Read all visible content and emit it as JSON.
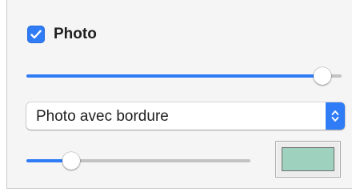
{
  "photo_section": {
    "checkbox": {
      "label": "Photo",
      "checked": true,
      "icon": "checkmark-icon",
      "accent_color": "#2f7cf6"
    },
    "size_slider": {
      "value_fraction": 0.94
    },
    "style_popup": {
      "selected": "Photo avec bordure",
      "icon": "up-down-chevron-icon"
    },
    "border_width_slider": {
      "value_fraction": 0.2
    },
    "border_color_well": {
      "color": "#9fd1bf"
    }
  }
}
